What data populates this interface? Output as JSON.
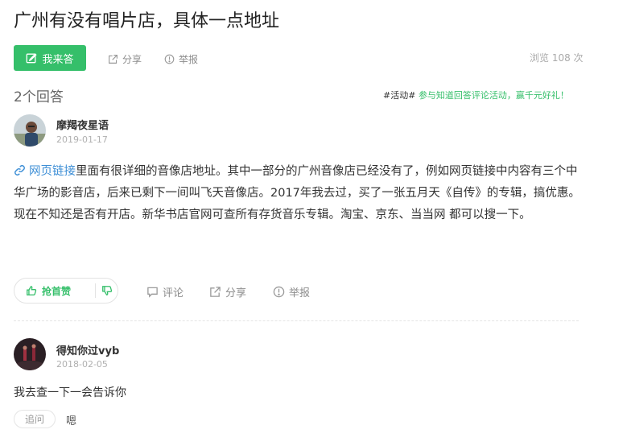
{
  "question": {
    "title": "广州有没有唱片店，具体一点地址",
    "answer_button": "我来答",
    "share": "分享",
    "report": "举报",
    "views": "浏览 108 次"
  },
  "answers_header": {
    "count": "2个回答",
    "promo_tag": "#活动#",
    "promo_text": "参与知道回答评论活动，赢千元好礼！"
  },
  "answer": {
    "author": "摩羯夜星语",
    "date": "2019-01-17",
    "link_text": "网页链接",
    "text": "里面有很详细的音像店地址。其中一部分的广州音像店已经没有了，例如网页链接中内容有三个中华广场的影音店，后来已剩下一间叫飞天音像店。2017年我去过，买了一张五月天《自传》的专辑，搞优惠。现在不知还是否有开店。新华书店官网可查所有存货音乐专辑。淘宝、京东、当当网 都可以搜一下。",
    "upvote": "抢首赞",
    "comment": "评论",
    "share": "分享",
    "report": "举报"
  },
  "comment": {
    "author": "得知你过vyb",
    "date": "2018-02-05",
    "text": "我去查一下一会告诉你",
    "followup": "追问",
    "reply": "嗯"
  },
  "colors": {
    "accent": "#35bf6a",
    "link": "#3e8fd6"
  }
}
